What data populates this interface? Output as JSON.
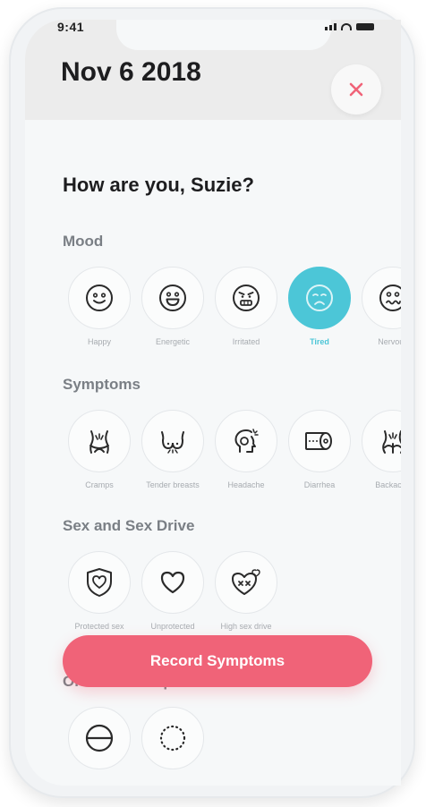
{
  "status_bar": {
    "time": "9:41"
  },
  "header": {
    "date": "Nov 6 2018",
    "close_icon": "close-icon"
  },
  "greeting": "How are you, Suzie?",
  "mood": {
    "title": "Mood",
    "items": [
      {
        "label": "Happy",
        "icon": "happy-face-icon"
      },
      {
        "label": "Energetic",
        "icon": "energetic-face-icon"
      },
      {
        "label": "Irritated",
        "icon": "irritated-face-icon"
      },
      {
        "label": "Tired",
        "icon": "tired-face-icon",
        "selected": true
      },
      {
        "label": "Nervous",
        "icon": "nervous-face-icon"
      }
    ]
  },
  "symptoms": {
    "title": "Symptoms",
    "items": [
      {
        "label": "Cramps",
        "icon": "cramps-icon"
      },
      {
        "label": "Tender breasts",
        "icon": "tender-breasts-icon"
      },
      {
        "label": "Headache",
        "icon": "headache-icon"
      },
      {
        "label": "Diarrhea",
        "icon": "diarrhea-icon"
      },
      {
        "label": "Backache",
        "icon": "backache-icon"
      }
    ]
  },
  "sex": {
    "title": "Sex and Sex Drive",
    "items": [
      {
        "label": "Protected sex",
        "icon": "protected-sex-icon"
      },
      {
        "label": "Unprotected sex",
        "icon": "unprotected-sex-icon"
      },
      {
        "label": "High sex drive",
        "icon": "high-sex-drive-icon"
      }
    ]
  },
  "contraceptives": {
    "title": "Oral Contraceptives",
    "items": [
      {
        "label": "",
        "icon": "pill-icon"
      },
      {
        "label": "",
        "icon": "dotted-circle-icon"
      }
    ]
  },
  "cta": {
    "label": "Record Symptoms"
  },
  "colors": {
    "accent": "#4cc6d7",
    "primary_button": "#f06378",
    "close": "#f06378"
  }
}
